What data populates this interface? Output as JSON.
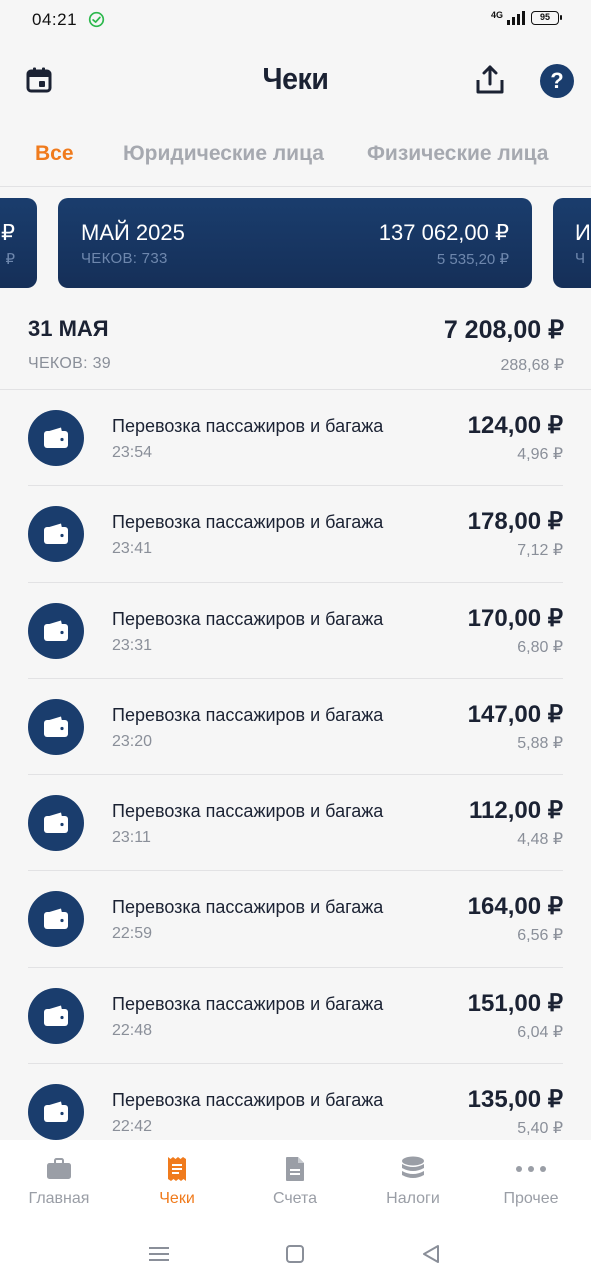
{
  "status_bar": {
    "time": "04:21",
    "network": "4G",
    "battery": "95"
  },
  "header": {
    "title": "Чеки"
  },
  "filter_tabs": [
    {
      "label": "Все",
      "active": true
    },
    {
      "label": "Юридические лица",
      "active": false
    },
    {
      "label": "Физические лица",
      "active": false
    }
  ],
  "months": {
    "prev_peek": {
      "amount": "₽",
      "tax": "₽"
    },
    "current": {
      "name": "МАЙ 2025",
      "count": "ЧЕКОВ: 733",
      "amount": "137 062,00 ₽",
      "tax": "5 535,20 ₽"
    },
    "next_peek": {
      "name": "И",
      "count": "Ч"
    }
  },
  "day": {
    "title": "31 МАЯ",
    "count": "ЧЕКОВ: 39",
    "total": "7 208,00 ₽",
    "tax": "288,68 ₽"
  },
  "receipts": [
    {
      "title": "Перевозка пассажиров и багажа",
      "time": "23:54",
      "amount": "124,00 ₽",
      "tax": "4,96 ₽"
    },
    {
      "title": "Перевозка пассажиров и багажа",
      "time": "23:41",
      "amount": "178,00 ₽",
      "tax": "7,12 ₽"
    },
    {
      "title": "Перевозка пассажиров и багажа",
      "time": "23:31",
      "amount": "170,00 ₽",
      "tax": "6,80 ₽"
    },
    {
      "title": "Перевозка пассажиров и багажа",
      "time": "23:20",
      "amount": "147,00 ₽",
      "tax": "5,88 ₽"
    },
    {
      "title": "Перевозка пассажиров и багажа",
      "time": "23:11",
      "amount": "112,00 ₽",
      "tax": "4,48 ₽"
    },
    {
      "title": "Перевозка пассажиров и багажа",
      "time": "22:59",
      "amount": "164,00 ₽",
      "tax": "6,56 ₽"
    },
    {
      "title": "Перевозка пассажиров и багажа",
      "time": "22:48",
      "amount": "151,00 ₽",
      "tax": "6,04 ₽"
    },
    {
      "title": "Перевозка пассажиров и багажа",
      "time": "22:42",
      "amount": "135,00 ₽",
      "tax": "5,40 ₽"
    }
  ],
  "bottom_nav": [
    {
      "label": "Главная",
      "icon": "briefcase-icon",
      "active": false
    },
    {
      "label": "Чеки",
      "icon": "receipt-icon",
      "active": true
    },
    {
      "label": "Счета",
      "icon": "document-icon",
      "active": false
    },
    {
      "label": "Налоги",
      "icon": "coins-icon",
      "active": false
    },
    {
      "label": "Прочее",
      "icon": "more-icon",
      "active": false
    }
  ],
  "colors": {
    "accent": "#f07b1d",
    "brand": "#1a3d6d",
    "text": "#1b2233",
    "muted": "#8a8f99",
    "status_ok": "#2db84d"
  }
}
